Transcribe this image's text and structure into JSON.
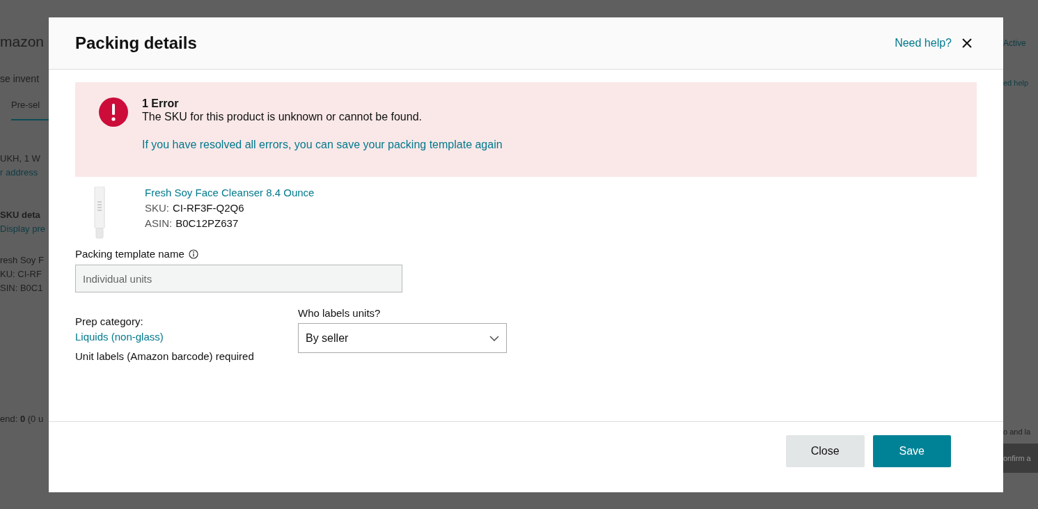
{
  "background": {
    "left_items": [
      {
        "kind": "logo",
        "text": "mazon"
      },
      {
        "kind": "heading",
        "text": "se invent"
      },
      {
        "kind": "tab",
        "text": "Pre-sel",
        "selected": true
      },
      {
        "kind": "text",
        "text": "UKH, 1 W"
      },
      {
        "kind": "link",
        "text": "r address"
      },
      {
        "kind": "bold",
        "text": "**SKU deta**"
      },
      {
        "kind": "link",
        "text": "Display pre"
      },
      {
        "kind": "text",
        "text": "resh Soy F"
      },
      {
        "kind": "text",
        "text": "KU: CI-RF"
      },
      {
        "kind": "text",
        "text": "SIN: B0C1"
      },
      {
        "kind": "footer",
        "text": "end: **0** (0 u"
      }
    ],
    "right_items": [
      {
        "kind": "logo",
        "text": "Active"
      },
      {
        "kind": "heading",
        "text": "ed help"
      },
      {
        "kind": "footer",
        "text": "o and la"
      },
      {
        "kind": "button",
        "text": "onfirm a"
      }
    ]
  },
  "modal": {
    "title": "Packing details",
    "help_link": "Need help?",
    "error": {
      "title": "1 Error",
      "message": "The SKU for this product is unknown or cannot be found.",
      "link": "If you have resolved all errors, you can save your packing template again"
    },
    "product": {
      "name": "Fresh Soy Face Cleanser 8.4 Ounce",
      "sku_label": "SKU:",
      "sku": "CI-RF3F-Q2Q6",
      "asin_label": "ASIN:",
      "asin": "B0C12PZ637"
    },
    "template_field": {
      "label": "Packing template name",
      "value": "Individual units",
      "disabled": true
    },
    "prep": {
      "label": "Prep category:",
      "category": "Liquids (non-glass)",
      "note": "Unit labels (Amazon barcode) required"
    },
    "who_labels": {
      "label": "Who labels units?",
      "value": "By seller"
    },
    "buttons": [
      {
        "label": "Close",
        "kind": "secondary"
      },
      {
        "label": "Save",
        "kind": "primary"
      }
    ]
  }
}
